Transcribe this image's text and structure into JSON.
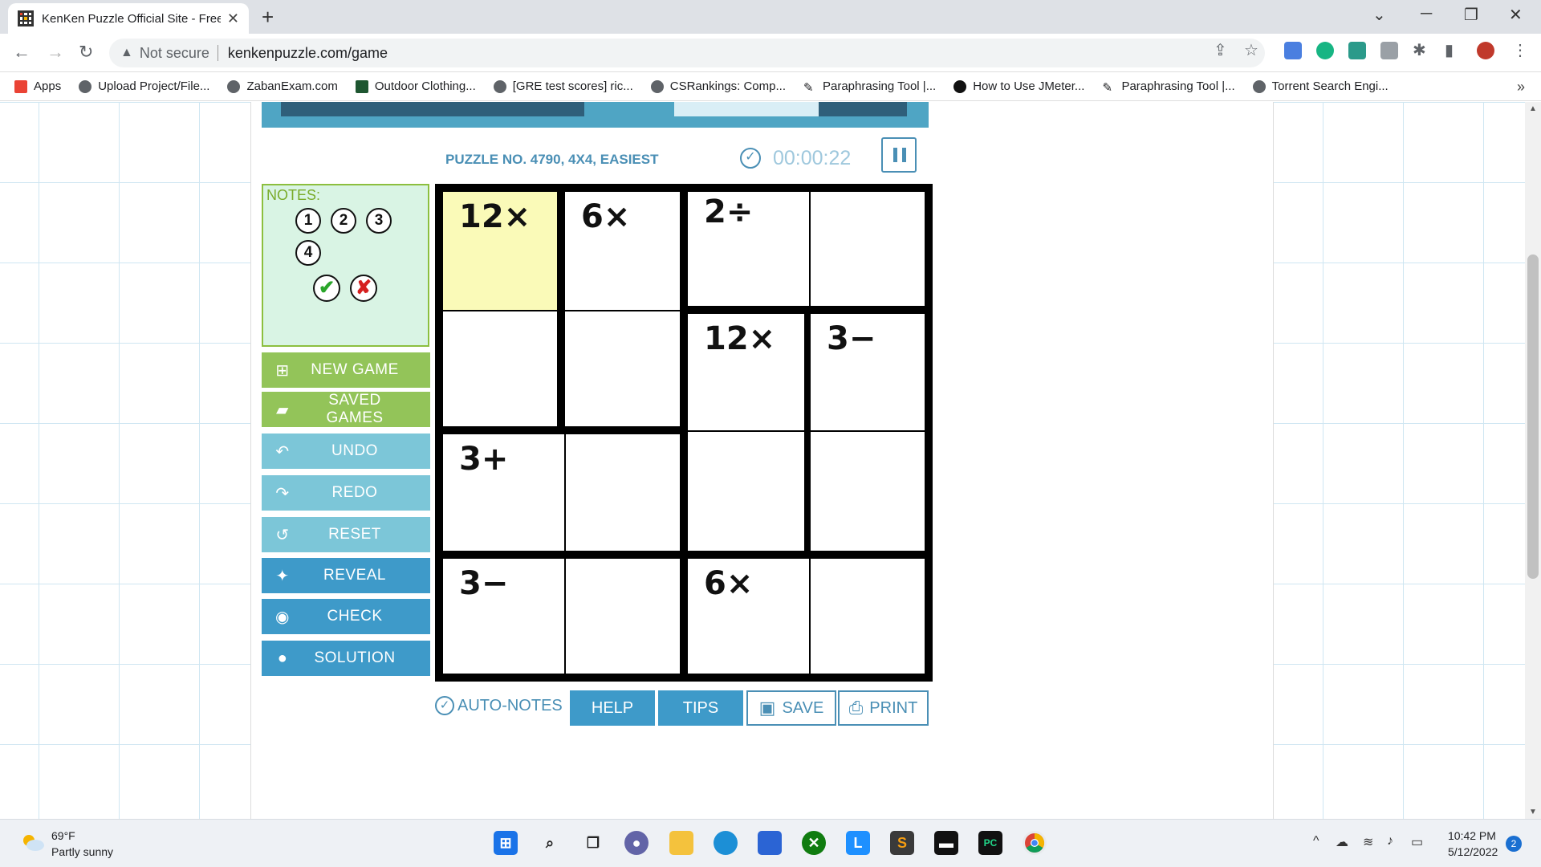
{
  "browser": {
    "tab_title": "KenKen Puzzle Official Site - Free",
    "tab_close": "✕",
    "new_tab": "+",
    "not_secure": "Not secure",
    "url": "kenkenpuzzle.com/game",
    "bookmarks": [
      {
        "label": "Apps"
      },
      {
        "label": "Upload Project/File..."
      },
      {
        "label": "ZabanExam.com"
      },
      {
        "label": "Outdoor Clothing..."
      },
      {
        "label": "[GRE test scores] ric..."
      },
      {
        "label": "CSRankings: Comp..."
      },
      {
        "label": "Paraphrasing Tool |..."
      },
      {
        "label": "How to Use JMeter..."
      },
      {
        "label": "Paraphrasing Tool |..."
      },
      {
        "label": "Torrent Search Engi..."
      }
    ]
  },
  "game": {
    "puzzle_info": "PUZZLE NO. 4790, 4X4, EASIEST",
    "timer": "00:00:22",
    "notes": {
      "label": "NOTES:",
      "numbers": [
        "1",
        "2",
        "3",
        "4"
      ],
      "accept": "✔",
      "reject": "✘"
    },
    "side_buttons": [
      {
        "label": "NEW GAME",
        "icon": "plus-folder-icon"
      },
      {
        "label": "SAVED GAMES",
        "icon": "folder-open-icon"
      },
      {
        "label": "UNDO",
        "icon": "undo-icon"
      },
      {
        "label": "REDO",
        "icon": "redo-icon"
      },
      {
        "label": "RESET",
        "icon": "reset-icon"
      },
      {
        "label": "REVEAL",
        "icon": "magic-wand-icon"
      },
      {
        "label": "CHECK",
        "icon": "eye-icon"
      },
      {
        "label": "SOLUTION",
        "icon": "lightbulb-icon"
      }
    ],
    "cages": [
      {
        "label": "12×"
      },
      {
        "label": "6×"
      },
      {
        "label": "2÷"
      },
      {
        "label": "12×"
      },
      {
        "label": "3−"
      },
      {
        "label": "3+"
      },
      {
        "label": "3−"
      },
      {
        "label": "6×"
      }
    ],
    "toolbar": {
      "auto_notes": "AUTO-NOTES",
      "help": "HELP",
      "tips": "TIPS",
      "save": "SAVE",
      "print": "PRINT"
    }
  },
  "taskbar": {
    "weather_temp": "69°F",
    "weather_desc": "Partly sunny",
    "time": "10:42 PM",
    "date": "5/12/2022",
    "notifications": "2"
  },
  "colors": {
    "accent_blue": "#3e9ac9",
    "accent_green": "#93c459",
    "selected_cell": "#fafab8"
  }
}
